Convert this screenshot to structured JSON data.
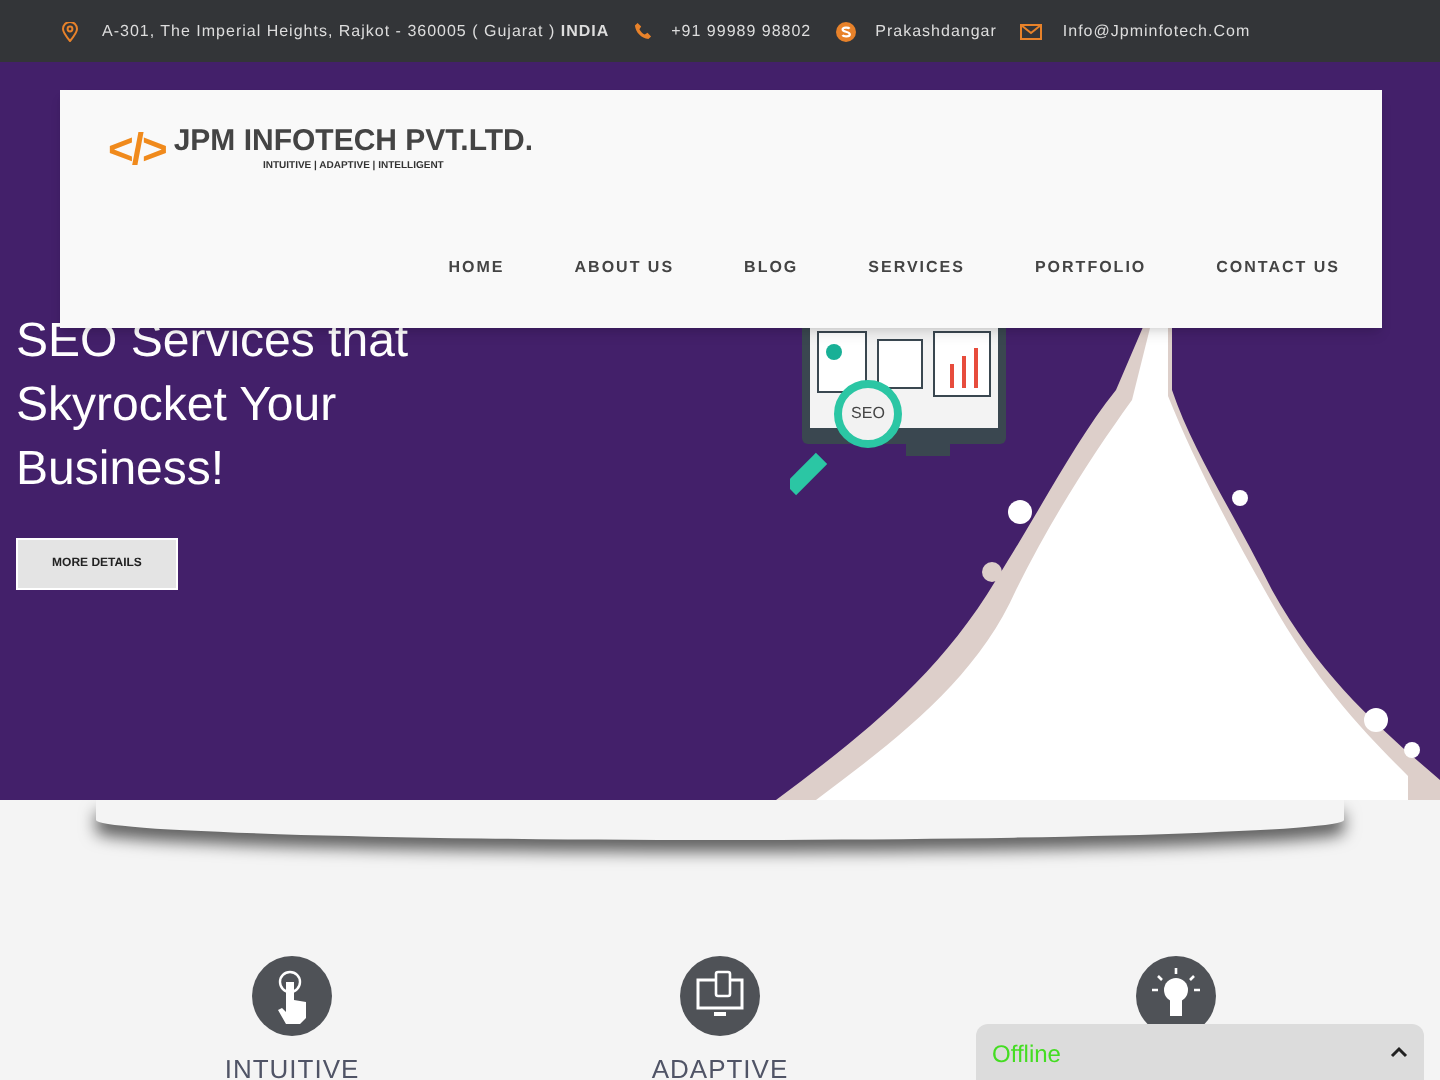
{
  "top_bar": {
    "address": {
      "text": "A-301, The Imperial Heights, Rajkot - 360005 ( Gujarat ) ",
      "country": "INDIA"
    },
    "phone": "+91 99989 98802",
    "skype": "Prakashdangar",
    "email": "Info@Jpminfotech.Com"
  },
  "logo": {
    "mark": "</>",
    "name": "JPM INFOTECH PVT.LTD.",
    "tagline": "INTUITIVE | ADAPTIVE | INTELLIGENT"
  },
  "nav": [
    {
      "label": "HOME"
    },
    {
      "label": "ABOUT US"
    },
    {
      "label": "BLOG"
    },
    {
      "label": "SERVICES"
    },
    {
      "label": "PORTFOLIO"
    },
    {
      "label": "CONTACT US"
    }
  ],
  "hero": {
    "title_lines": [
      "SEO Services that",
      "Skyrocket Your",
      "Business!"
    ],
    "button": "MORE DETAILS",
    "badge": "SEO"
  },
  "features": [
    {
      "kind": "touch",
      "label": "INTUITIVE"
    },
    {
      "kind": "devices",
      "label": "ADAPTIVE"
    },
    {
      "kind": "bulb"
    }
  ],
  "chat": {
    "status": "Offline",
    "expanded": false
  }
}
